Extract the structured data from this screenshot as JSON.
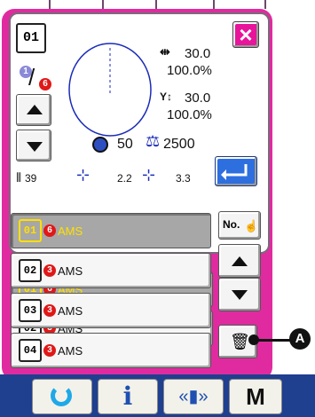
{
  "header": {
    "pattern_number": "01"
  },
  "counter": {
    "current": "1",
    "total": "6"
  },
  "scale": {
    "x_value": "30.0",
    "x_percent": "100.0%",
    "y_value": "30.0",
    "y_percent": "100.0%"
  },
  "stats": {
    "speed": "50",
    "count": "2500"
  },
  "stitch": {
    "stitch_count": "39",
    "x_pitch": "2.2",
    "y_pitch": "3.3"
  },
  "list": {
    "items": [
      {
        "number": "01",
        "badge": "6",
        "label": "AMS"
      },
      {
        "number": "02",
        "badge": "3",
        "label": "AMS"
      },
      {
        "number": "03",
        "badge": "3",
        "label": "AMS"
      },
      {
        "number": "04",
        "badge": "3",
        "label": "AMS"
      }
    ]
  },
  "buttons": {
    "no_label": "No.",
    "close": "×"
  },
  "callout": {
    "label": "A"
  },
  "bottom_bar": {
    "info": "i",
    "mode": "M"
  },
  "colors": {
    "frame": "#e02ba0",
    "bottom": "#1f3f8f",
    "badge": "#e01818",
    "selected_text": "#ffe000"
  }
}
